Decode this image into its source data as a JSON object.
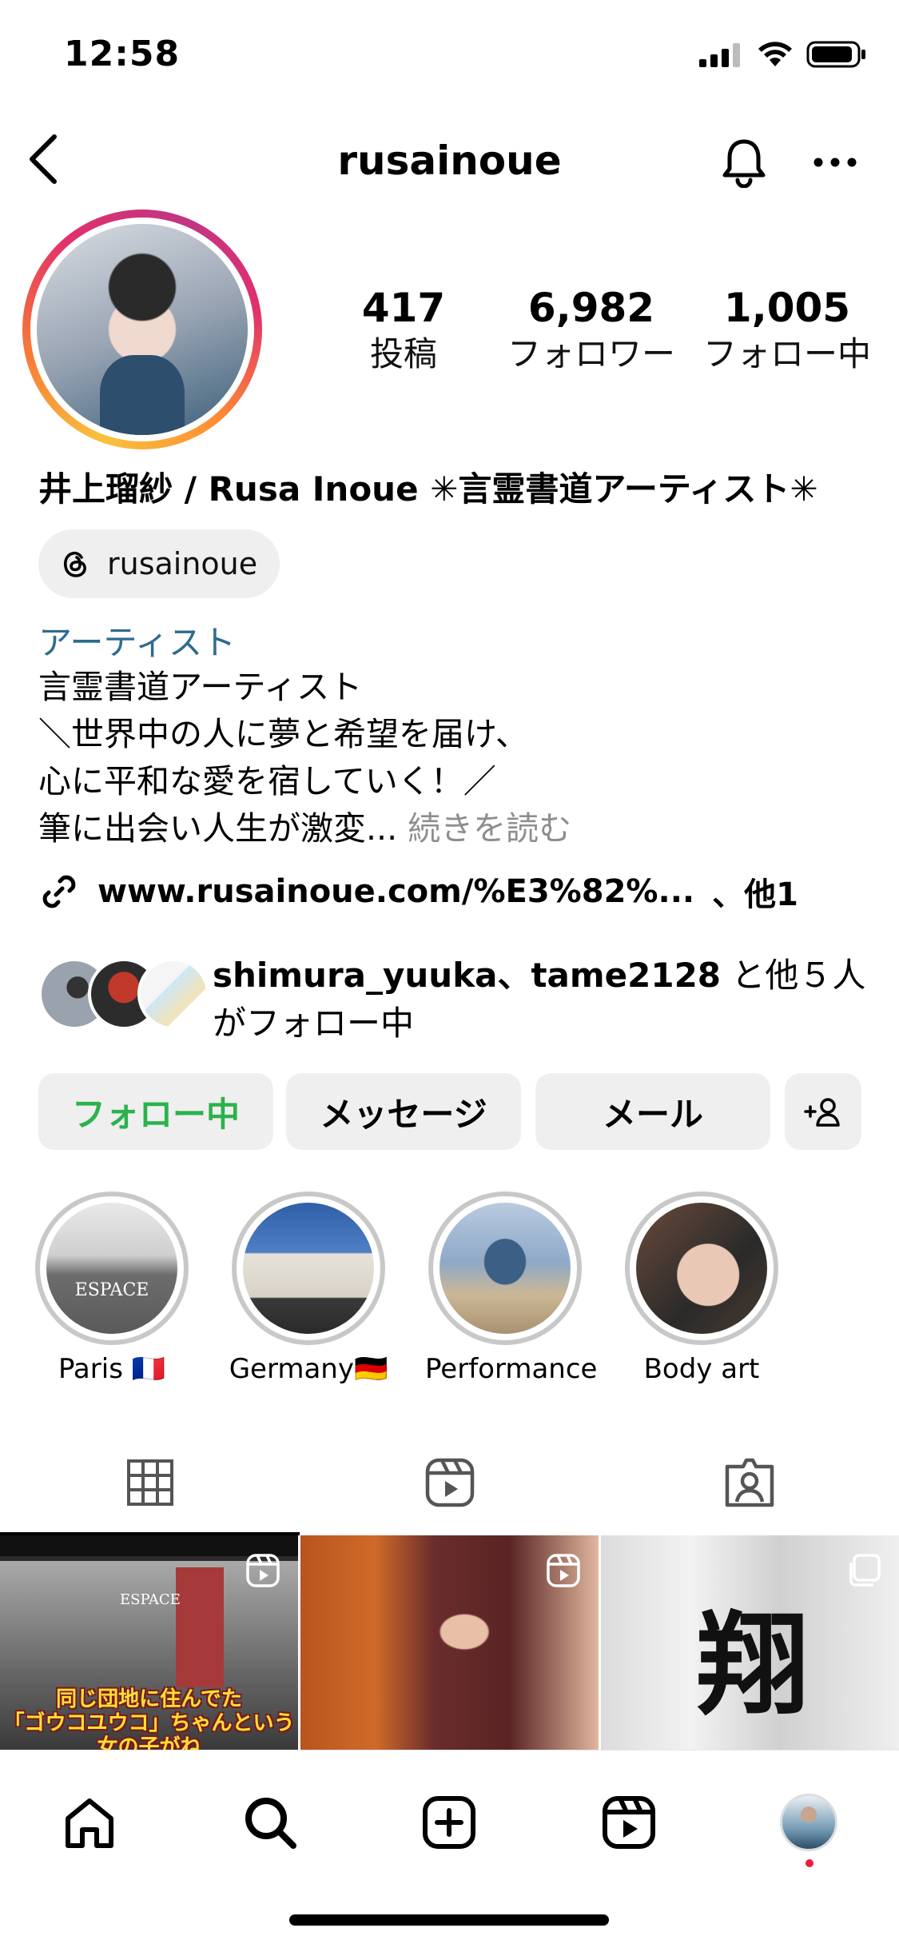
{
  "status_bar": {
    "time": "12:58"
  },
  "header": {
    "username": "rusainoue"
  },
  "profile": {
    "stats": [
      {
        "value": "417",
        "label": "投稿"
      },
      {
        "value": "6,982",
        "label": "フォロワー"
      },
      {
        "value": "1,005",
        "label": "フォロー中"
      }
    ],
    "display_name": "井上瑠紗 / Rusa Inoue ✳言霊書道アーティスト✳",
    "threads_handle": "rusainoue",
    "category": "アーティスト",
    "bio_lines": [
      "言霊書道アーティスト",
      "＼世界中の人に夢と希望を届け、",
      "心に平和な愛を宿していく！／",
      "筆に出会い人生が激変..."
    ],
    "bio_more": " 続きを読む",
    "link": "www.rusainoue.com/%E3%82%...",
    "link_extra": "、他1",
    "followed_by": {
      "names": "shimura_yuuka、tame2128",
      "suffix": "と他５人",
      "line2": "がフォロー中"
    }
  },
  "actions": {
    "following": "フォロー中",
    "message": "メッセージ",
    "email": "メール"
  },
  "highlights": [
    {
      "label": "Paris 🇫🇷"
    },
    {
      "label": "Germany🇩🇪"
    },
    {
      "label": "Performance"
    },
    {
      "label": "Body art"
    }
  ],
  "posts": [
    {
      "caption_top": "同じ団地に住んでた",
      "caption_mid": "「ゴウコユウコ」ちゃんという",
      "caption_bot": "女の子がね",
      "sign": "ESPACE"
    },
    {
      "text": ""
    },
    {
      "text": "翔"
    }
  ],
  "colors": {
    "following_green": "#2bb24c",
    "category_blue": "#2f6b8f",
    "button_bg": "#efefef"
  }
}
